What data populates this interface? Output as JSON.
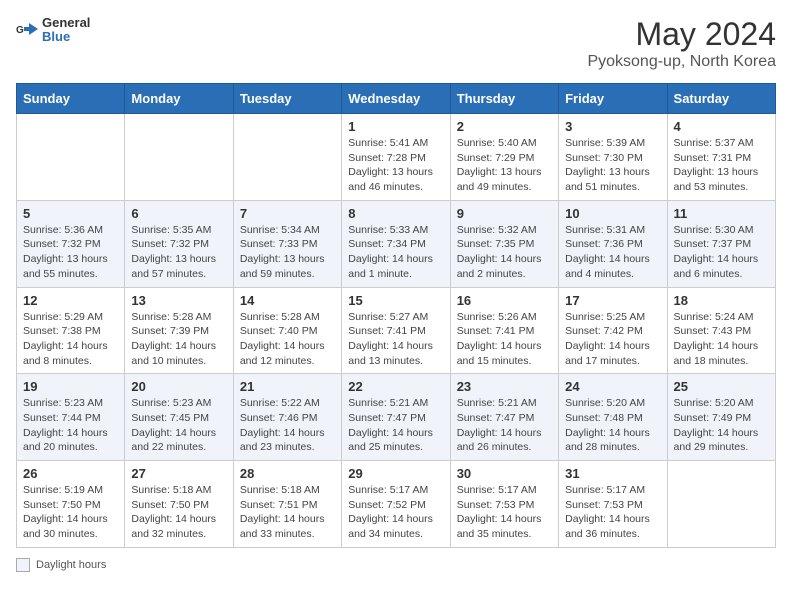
{
  "header": {
    "logo_general": "General",
    "logo_blue": "Blue",
    "title": "May 2024",
    "subtitle": "Pyoksong-up, North Korea"
  },
  "footer": {
    "label": "Daylight hours"
  },
  "columns": [
    "Sunday",
    "Monday",
    "Tuesday",
    "Wednesday",
    "Thursday",
    "Friday",
    "Saturday"
  ],
  "weeks": [
    [
      {
        "day": "",
        "info": ""
      },
      {
        "day": "",
        "info": ""
      },
      {
        "day": "",
        "info": ""
      },
      {
        "day": "1",
        "info": "Sunrise: 5:41 AM\nSunset: 7:28 PM\nDaylight: 13 hours and 46 minutes."
      },
      {
        "day": "2",
        "info": "Sunrise: 5:40 AM\nSunset: 7:29 PM\nDaylight: 13 hours and 49 minutes."
      },
      {
        "day": "3",
        "info": "Sunrise: 5:39 AM\nSunset: 7:30 PM\nDaylight: 13 hours and 51 minutes."
      },
      {
        "day": "4",
        "info": "Sunrise: 5:37 AM\nSunset: 7:31 PM\nDaylight: 13 hours and 53 minutes."
      }
    ],
    [
      {
        "day": "5",
        "info": "Sunrise: 5:36 AM\nSunset: 7:32 PM\nDaylight: 13 hours and 55 minutes."
      },
      {
        "day": "6",
        "info": "Sunrise: 5:35 AM\nSunset: 7:32 PM\nDaylight: 13 hours and 57 minutes."
      },
      {
        "day": "7",
        "info": "Sunrise: 5:34 AM\nSunset: 7:33 PM\nDaylight: 13 hours and 59 minutes."
      },
      {
        "day": "8",
        "info": "Sunrise: 5:33 AM\nSunset: 7:34 PM\nDaylight: 14 hours and 1 minute."
      },
      {
        "day": "9",
        "info": "Sunrise: 5:32 AM\nSunset: 7:35 PM\nDaylight: 14 hours and 2 minutes."
      },
      {
        "day": "10",
        "info": "Sunrise: 5:31 AM\nSunset: 7:36 PM\nDaylight: 14 hours and 4 minutes."
      },
      {
        "day": "11",
        "info": "Sunrise: 5:30 AM\nSunset: 7:37 PM\nDaylight: 14 hours and 6 minutes."
      }
    ],
    [
      {
        "day": "12",
        "info": "Sunrise: 5:29 AM\nSunset: 7:38 PM\nDaylight: 14 hours and 8 minutes."
      },
      {
        "day": "13",
        "info": "Sunrise: 5:28 AM\nSunset: 7:39 PM\nDaylight: 14 hours and 10 minutes."
      },
      {
        "day": "14",
        "info": "Sunrise: 5:28 AM\nSunset: 7:40 PM\nDaylight: 14 hours and 12 minutes."
      },
      {
        "day": "15",
        "info": "Sunrise: 5:27 AM\nSunset: 7:41 PM\nDaylight: 14 hours and 13 minutes."
      },
      {
        "day": "16",
        "info": "Sunrise: 5:26 AM\nSunset: 7:41 PM\nDaylight: 14 hours and 15 minutes."
      },
      {
        "day": "17",
        "info": "Sunrise: 5:25 AM\nSunset: 7:42 PM\nDaylight: 14 hours and 17 minutes."
      },
      {
        "day": "18",
        "info": "Sunrise: 5:24 AM\nSunset: 7:43 PM\nDaylight: 14 hours and 18 minutes."
      }
    ],
    [
      {
        "day": "19",
        "info": "Sunrise: 5:23 AM\nSunset: 7:44 PM\nDaylight: 14 hours and 20 minutes."
      },
      {
        "day": "20",
        "info": "Sunrise: 5:23 AM\nSunset: 7:45 PM\nDaylight: 14 hours and 22 minutes."
      },
      {
        "day": "21",
        "info": "Sunrise: 5:22 AM\nSunset: 7:46 PM\nDaylight: 14 hours and 23 minutes."
      },
      {
        "day": "22",
        "info": "Sunrise: 5:21 AM\nSunset: 7:47 PM\nDaylight: 14 hours and 25 minutes."
      },
      {
        "day": "23",
        "info": "Sunrise: 5:21 AM\nSunset: 7:47 PM\nDaylight: 14 hours and 26 minutes."
      },
      {
        "day": "24",
        "info": "Sunrise: 5:20 AM\nSunset: 7:48 PM\nDaylight: 14 hours and 28 minutes."
      },
      {
        "day": "25",
        "info": "Sunrise: 5:20 AM\nSunset: 7:49 PM\nDaylight: 14 hours and 29 minutes."
      }
    ],
    [
      {
        "day": "26",
        "info": "Sunrise: 5:19 AM\nSunset: 7:50 PM\nDaylight: 14 hours and 30 minutes."
      },
      {
        "day": "27",
        "info": "Sunrise: 5:18 AM\nSunset: 7:50 PM\nDaylight: 14 hours and 32 minutes."
      },
      {
        "day": "28",
        "info": "Sunrise: 5:18 AM\nSunset: 7:51 PM\nDaylight: 14 hours and 33 minutes."
      },
      {
        "day": "29",
        "info": "Sunrise: 5:17 AM\nSunset: 7:52 PM\nDaylight: 14 hours and 34 minutes."
      },
      {
        "day": "30",
        "info": "Sunrise: 5:17 AM\nSunset: 7:53 PM\nDaylight: 14 hours and 35 minutes."
      },
      {
        "day": "31",
        "info": "Sunrise: 5:17 AM\nSunset: 7:53 PM\nDaylight: 14 hours and 36 minutes."
      },
      {
        "day": "",
        "info": ""
      }
    ]
  ]
}
